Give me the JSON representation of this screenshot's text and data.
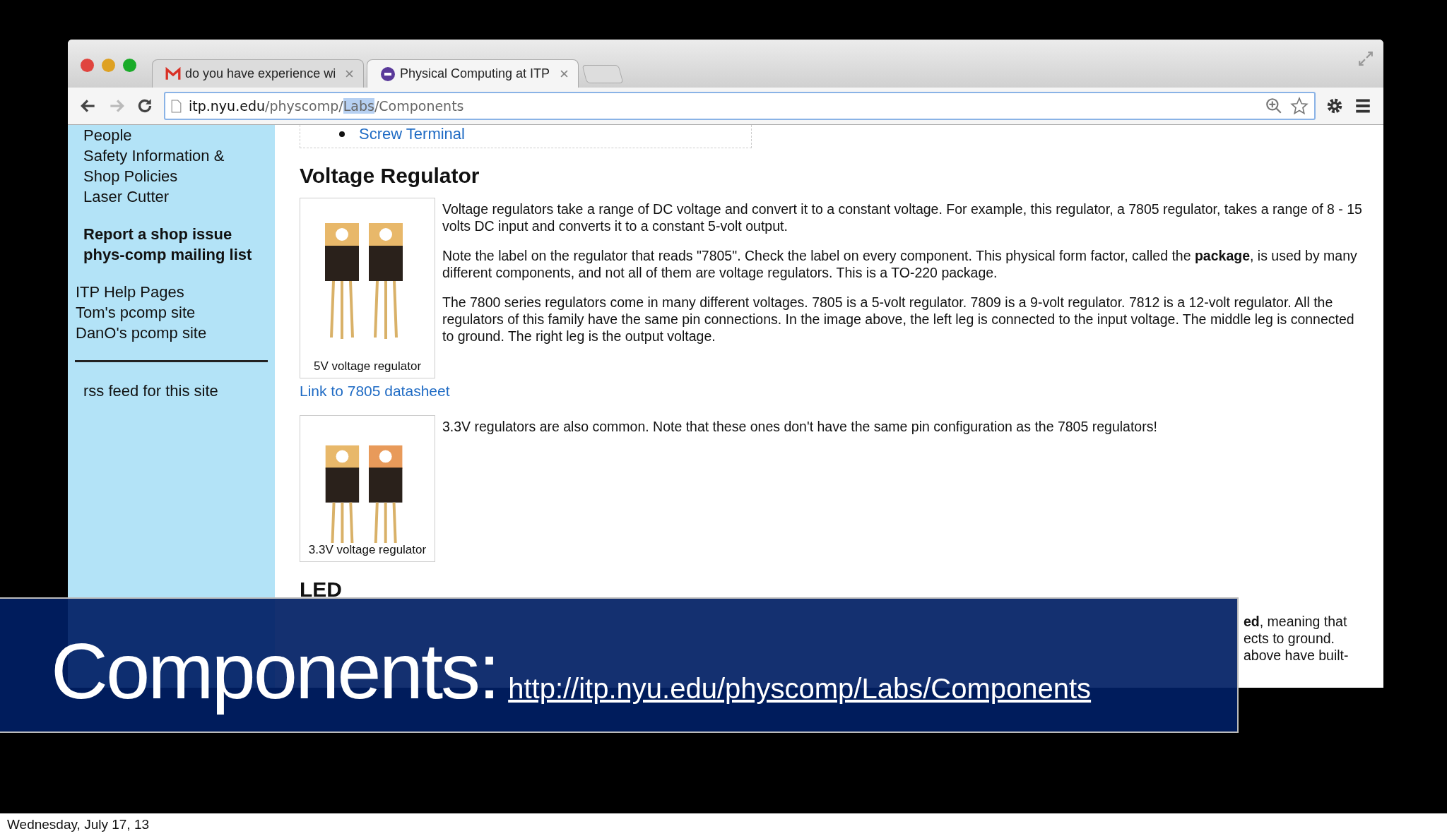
{
  "browser": {
    "tabs": [
      {
        "kind": "mail",
        "title": "do you have experience wi",
        "selected": false
      },
      {
        "kind": "site",
        "title": "Physical Computing at ITP",
        "selected": true
      }
    ],
    "address": {
      "host": "itp.nyu.edu",
      "path_start": "/physcomp/",
      "highlighted": "Labs",
      "path_end": "/Components"
    }
  },
  "sidebar": {
    "sections": [
      {
        "kind": "nav",
        "items": [
          "People",
          "Safety Information &",
          "Shop Policies",
          "Laser Cutter"
        ]
      },
      {
        "kind": "strong",
        "items": [
          "Report a shop issue",
          "phys-comp mailing list"
        ]
      },
      {
        "kind": "help",
        "items": [
          "ITP Help Pages",
          "Tom's pcomp site",
          "DanO's pcomp site"
        ]
      },
      {
        "kind": "feed",
        "items": [
          "rss feed for this site"
        ]
      }
    ]
  },
  "content": {
    "top_list": [
      "Screw Terminal"
    ],
    "heading": "Voltage Regulator",
    "figures": [
      {
        "caption": "5V voltage regulator",
        "paragraphs": [
          "Voltage regulators take a range of DC voltage and convert it to a constant voltage. For example, this regulator, a 7805 regulator, takes a range of 8 - 15 volts DC input and converts it to a constant 5-volt output.",
          "Note the label on the regulator that reads \"7805\". Check the label on every component. This physical form factor, called the **package**, is used by many different components, and not all of them are voltage regulators. This is a TO-220 package.",
          "The 7800 series regulators come in many different voltages. 7805 is a 5-volt regulator. 7809 is a 9-volt regulator. 7812 is a 12-volt regulator. All the regulators of this family have the same pin connections. In the image above, the left leg is connected to the input voltage. The middle leg is connected to ground. The right leg is the output voltage."
        ],
        "link": "Link to 7805 datasheet"
      },
      {
        "caption": "3.3V voltage regulator",
        "paragraphs": [
          "3.3V regulators are also common. Note that these ones don't have the same pin configuration as the 7805 regulators!"
        ]
      }
    ],
    "led_heading": "LED",
    "led_visible_lines": [
      "**ed**, meaning that",
      "ects to ground.",
      "above have built-"
    ]
  },
  "banner": {
    "title": "Components:",
    "url": "http://itp.nyu.edu/physcomp/Labs/Components"
  },
  "footer": {
    "date": "Wednesday, July 17, 13"
  }
}
